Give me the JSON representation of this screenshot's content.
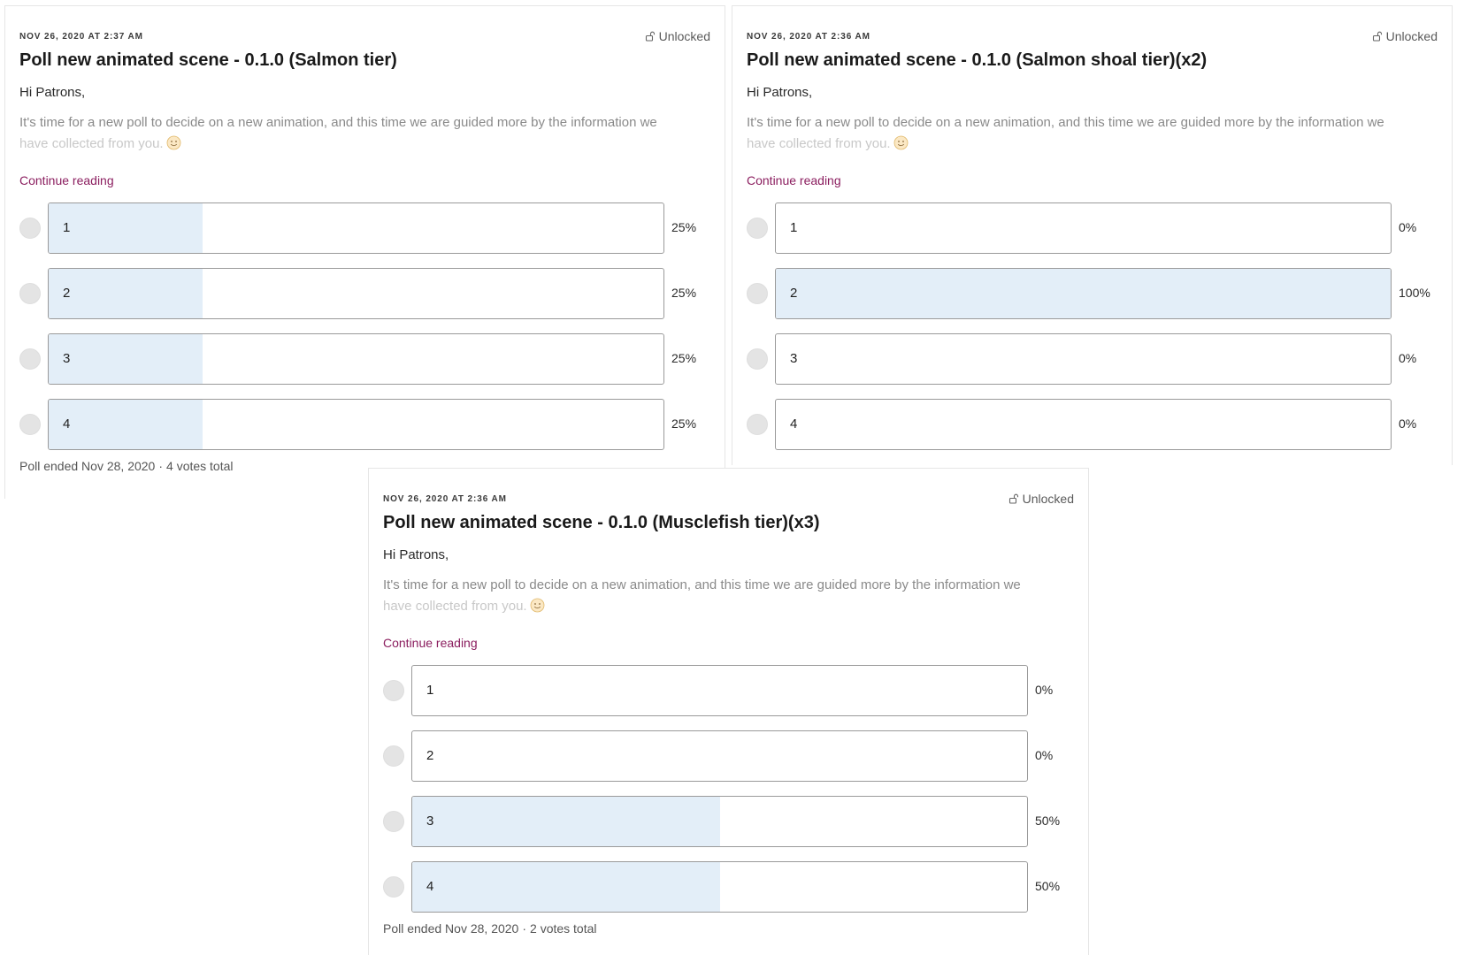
{
  "posts": [
    {
      "date": "NOV 26, 2020 AT 2:37 AM",
      "access": "Unlocked",
      "title": "Poll new animated scene - 0.1.0 (Salmon tier)",
      "greeting": "Hi Patrons,",
      "teaser_line1": "It's time for a new poll to decide on a new animation, and this time we are guided more by the information we",
      "teaser_line2": "have collected from you.",
      "continue_label": "Continue reading",
      "options": [
        {
          "label": "1",
          "percent_label": "25%",
          "fraction": 0.25
        },
        {
          "label": "2",
          "percent_label": "25%",
          "fraction": 0.25
        },
        {
          "label": "3",
          "percent_label": "25%",
          "fraction": 0.25
        },
        {
          "label": "4",
          "percent_label": "25%",
          "fraction": 0.25
        }
      ],
      "footer_ended": "Poll ended Nov 28, 2020",
      "footer_votes": "4 votes total"
    },
    {
      "date": "NOV 26, 2020 AT 2:36 AM",
      "access": "Unlocked",
      "title": "Poll new animated scene - 0.1.0 (Salmon shoal tier)(x2)",
      "greeting": "Hi Patrons,",
      "teaser_line1": "It's time for a new poll to decide on a new animation, and this time we are guided more by the information we",
      "teaser_line2": "have collected from you.",
      "continue_label": "Continue reading",
      "options": [
        {
          "label": "1",
          "percent_label": "0%",
          "fraction": 0
        },
        {
          "label": "2",
          "percent_label": "100%",
          "fraction": 1
        },
        {
          "label": "3",
          "percent_label": "0%",
          "fraction": 0
        },
        {
          "label": "4",
          "percent_label": "0%",
          "fraction": 0
        }
      ]
    },
    {
      "date": "NOV 26, 2020 AT 2:36 AM",
      "access": "Unlocked",
      "title": "Poll new animated scene - 0.1.0 (Musclefish tier)(x3)",
      "greeting": "Hi Patrons,",
      "teaser_line1": "It's time for a new poll to decide on a new animation, and this time we are guided more by the information we",
      "teaser_line2": "have collected from you.",
      "continue_label": "Continue reading",
      "options": [
        {
          "label": "1",
          "percent_label": "0%",
          "fraction": 0
        },
        {
          "label": "2",
          "percent_label": "0%",
          "fraction": 0
        },
        {
          "label": "3",
          "percent_label": "50%",
          "fraction": 0.5
        },
        {
          "label": "4",
          "percent_label": "50%",
          "fraction": 0.5
        }
      ],
      "footer_ended": "Poll ended Nov 28, 2020",
      "footer_votes": "2 votes total"
    }
  ],
  "colors": {
    "accent_link": "#8b1e5f",
    "bar_fill": "#e3eef8",
    "radio": "#e4e4e4"
  },
  "icons": {
    "access": "lock-open-icon",
    "emoji": "smiling-face-icon"
  }
}
